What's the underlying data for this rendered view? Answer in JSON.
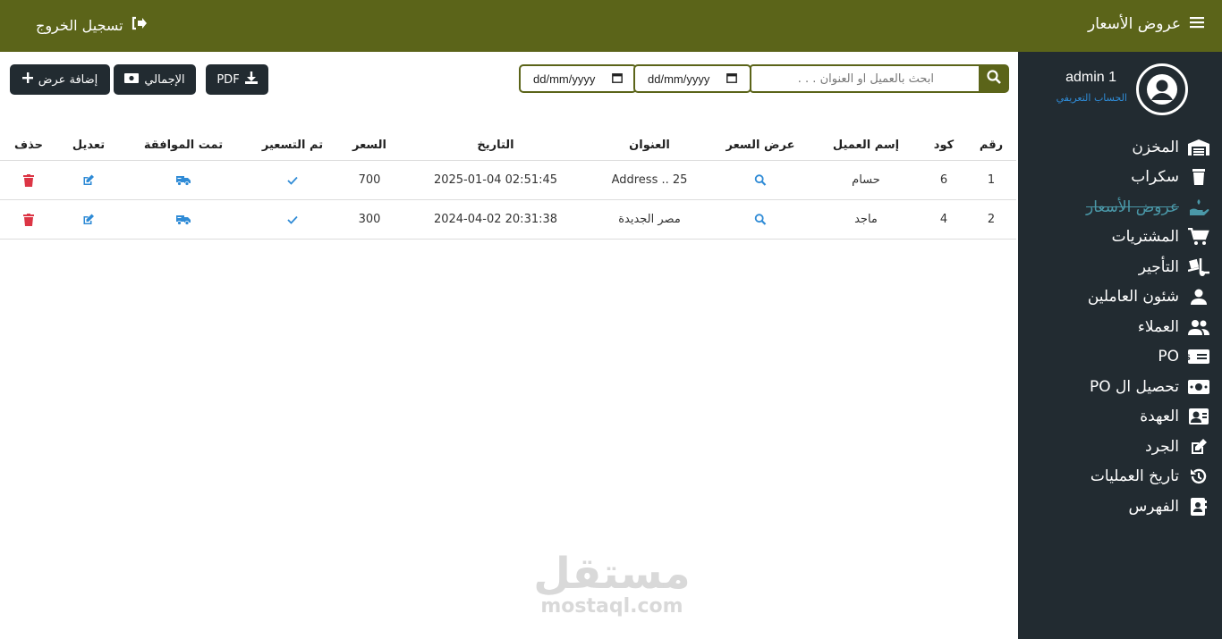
{
  "header": {
    "title": "عروض الأسعار",
    "logout_label": "تسجيل الخروج"
  },
  "profile": {
    "name": "admin 1",
    "link": "الحساب التعريفي"
  },
  "sidebar": {
    "items": [
      {
        "label": "المخزن",
        "icon": "warehouse-icon"
      },
      {
        "label": "سكراب",
        "icon": "trash-bin-icon"
      },
      {
        "label": "عروض الأسعار",
        "icon": "hand-holding-icon",
        "active": true
      },
      {
        "label": "المشتريات",
        "icon": "cart-icon"
      },
      {
        "label": "التأجير",
        "icon": "truck-ramp-icon"
      },
      {
        "label": "شئون العاملين",
        "icon": "user-icon"
      },
      {
        "label": "العملاء",
        "icon": "users-icon"
      },
      {
        "label": "PO",
        "icon": "money-check-icon"
      },
      {
        "label": "تحصيل ال PO",
        "icon": "money-bill-icon"
      },
      {
        "label": "العهدة",
        "icon": "id-badge-icon"
      },
      {
        "label": "الجرد",
        "icon": "edit-icon"
      },
      {
        "label": "تاريخ العمليات",
        "icon": "history-icon"
      },
      {
        "label": "الفهرس",
        "icon": "address-book-icon"
      }
    ]
  },
  "toolbar": {
    "add_label": "إضافة عرض",
    "total_label": "الإجمالي",
    "pdf_label": "PDF",
    "date_from_placeholder": "dd/mm/yyyy",
    "date_to_placeholder": "dd/mm/yyyy",
    "search_placeholder": "ابحث بالعميل او العنوان . . ."
  },
  "table": {
    "headers": {
      "num": "رقم",
      "code": "كود",
      "name": "إسم العميل",
      "view": "عرض السعر",
      "address": "العنوان",
      "date": "التاريخ",
      "price": "السعر",
      "priced": "تم التسعير",
      "approved": "تمت الموافقة",
      "edit": "تعديل",
      "delete": "حذف"
    },
    "rows": [
      {
        "num": "1",
        "code": "6",
        "name": "حسام",
        "address": "Address .. 25",
        "date": "2025-01-04 02:51:45",
        "price": "700"
      },
      {
        "num": "2",
        "code": "4",
        "name": "ماجد",
        "address": "مصر الجديدة",
        "date": "2024-04-02 20:31:38",
        "price": "300"
      }
    ]
  },
  "watermark": {
    "arabic": "مستقل",
    "latin": "mostaql.com"
  },
  "colors": {
    "brand": "#5b6419",
    "sidebar": "#222b31",
    "link": "#2f8bd6",
    "danger": "#dc3545",
    "active_item": "#4a98a8"
  }
}
